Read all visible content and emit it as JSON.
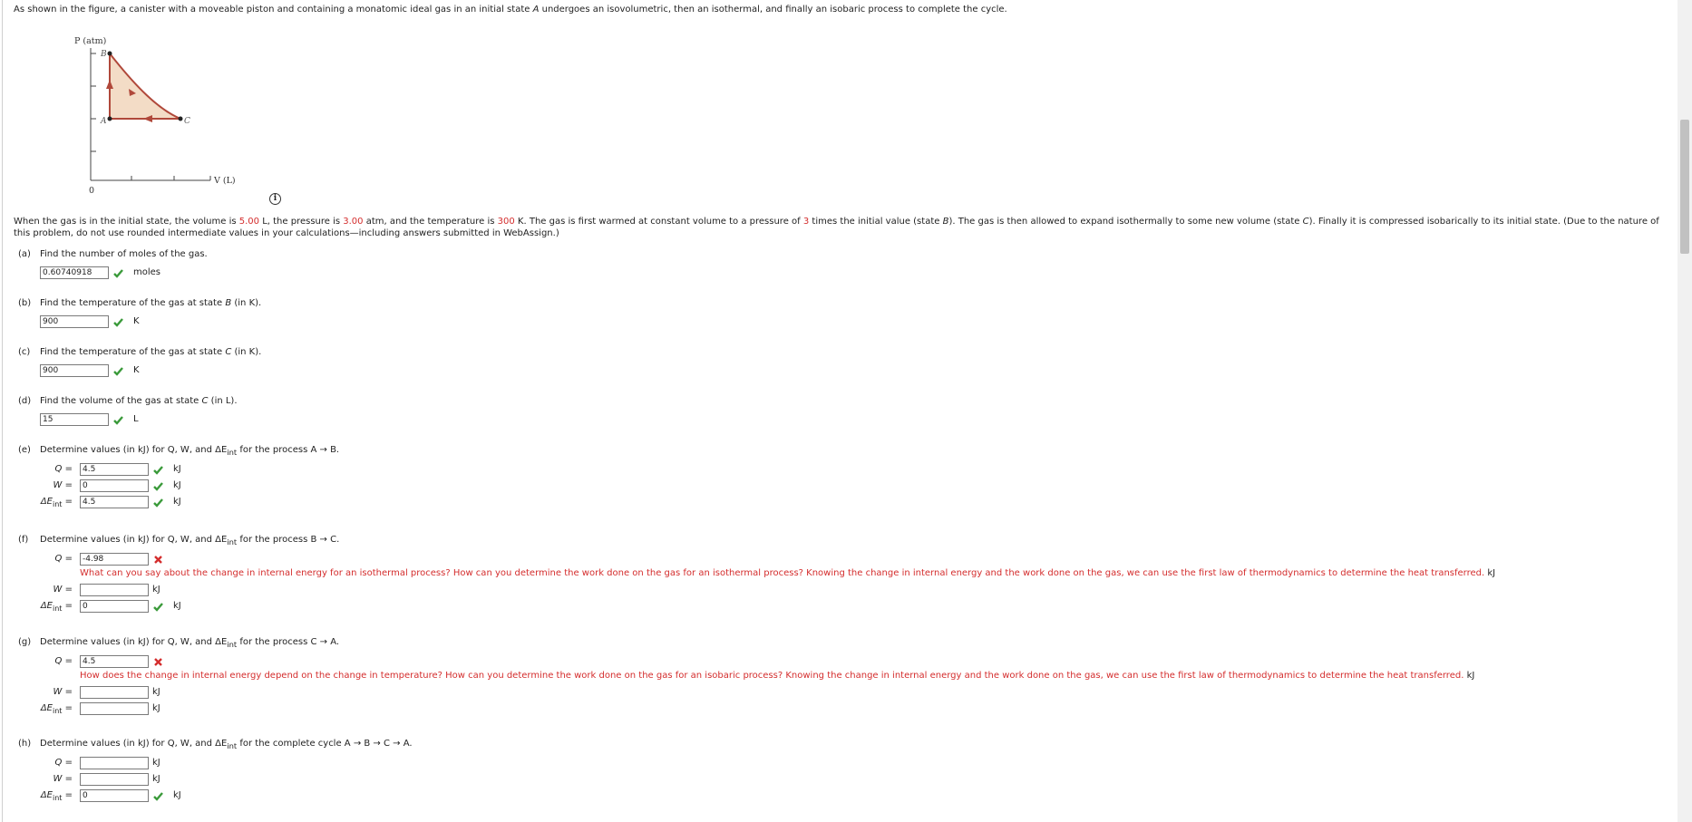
{
  "intro": {
    "before_a": "As shown in the figure, a canister with a moveable piston and containing a monatomic ideal gas in an initial state ",
    "state_a": "A",
    "after_a": " undergoes an isovolumetric, then an isothermal, and finally an isobaric process to complete the cycle."
  },
  "figure": {
    "ylabel": "P (atm)",
    "xlabel": "V (L)",
    "origin": "0",
    "point_a": "A",
    "point_b": "B",
    "point_c": "C"
  },
  "problem": {
    "p1": "When the gas is in the initial state, the volume is ",
    "v1": "5.00",
    "p2": " L, the pressure is ",
    "v2": "3.00",
    "p3": " atm, and the temperature is ",
    "v3": "300",
    "p4": " K. The gas is first warmed at constant volume to a pressure of ",
    "v4": "3",
    "p5": " times the initial value (state ",
    "sb": "B",
    "p6": "). The gas is then allowed to expand isothermally to some new volume (state ",
    "sc": "C",
    "p7": "). Finally it is compressed isobarically to its initial state. (Due to the nature of this problem, do not use rounded intermediate values in your calculations—including answers submitted in WebAssign.)"
  },
  "parts": {
    "a": {
      "tag": "(a)",
      "question": "Find the number of moles of the gas.",
      "value": "0.60740918",
      "unit": "moles"
    },
    "b": {
      "tag": "(b)",
      "question_pre": "Find the temperature of the gas at state ",
      "state": "B",
      "question_post": " (in K).",
      "value": "900",
      "unit": "K"
    },
    "c": {
      "tag": "(c)",
      "question_pre": "Find the temperature of the gas at state ",
      "state": "C",
      "question_post": " (in K).",
      "value": "900",
      "unit": "K"
    },
    "d": {
      "tag": "(d)",
      "question_pre": "Find the volume of the gas at state ",
      "state": "C",
      "question_post": " (in L).",
      "value": "15",
      "unit": "L"
    },
    "e": {
      "tag": "(e)",
      "question_pre": "Determine values (in kJ) for Q, W, and ΔE",
      "sub": "int",
      "question_post": " for the process A → B.",
      "q_value": "4.5",
      "w_value": "0",
      "de_value": "4.5",
      "unit": "kJ"
    },
    "f": {
      "tag": "(f)",
      "question_pre": "Determine values (in kJ) for Q, W, and ΔE",
      "sub": "int",
      "question_post": " for the process B → C.",
      "q_value": "-4.98",
      "w_value": "",
      "de_value": "0",
      "unit": "kJ",
      "hint": "What can you say about the change in internal energy for an isothermal process? How can you determine the work done on the gas for an isothermal process? Knowing the change in internal energy and the work done on the gas, we can use the first law of thermodynamics to determine the heat transferred."
    },
    "g": {
      "tag": "(g)",
      "question_pre": "Determine values (in kJ) for Q, W, and ΔE",
      "sub": "int",
      "question_post": " for the process C → A.",
      "q_value": "4.5",
      "w_value": "",
      "de_value": "",
      "unit": "kJ",
      "hint": "How does the change in internal energy depend on the change in temperature? How can you determine the work done on the gas for an isobaric process? Knowing the change in internal energy and the work done on the gas, we can use the first law of thermodynamics to determine the heat transferred."
    },
    "h": {
      "tag": "(h)",
      "question_pre": "Determine values (in kJ) for Q, W, and ΔE",
      "sub": "int",
      "question_post": " for the complete cycle A → B → C → A.",
      "q_value": "",
      "w_value": "",
      "de_value": "0",
      "unit": "kJ"
    }
  },
  "labels": {
    "q": "Q",
    "w": "W",
    "de": "ΔE",
    "de_sub": "int",
    "eq": "="
  },
  "colors": {
    "correct": "#3a9a3a",
    "incorrect": "#d42d2d",
    "highlight": "#d42d2d",
    "cycle_line": "#b0483a",
    "cycle_fill": "#f3dcc6"
  }
}
